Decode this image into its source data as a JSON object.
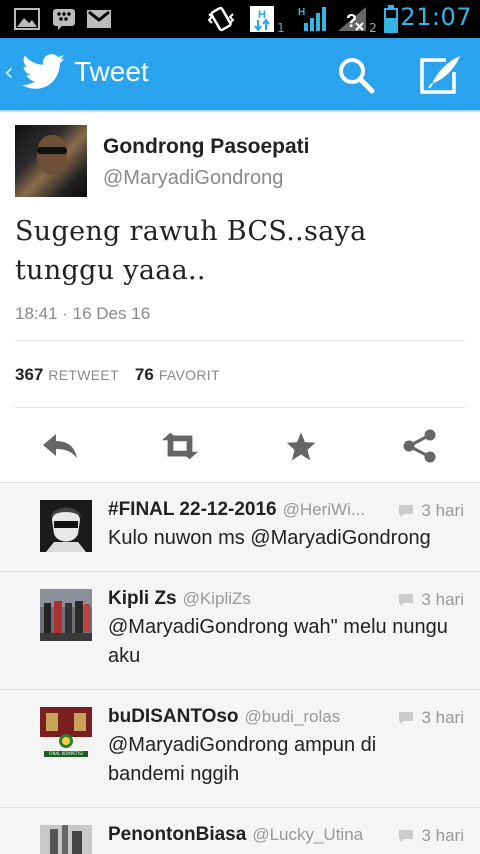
{
  "status_bar": {
    "time": "21:07",
    "network_h1": "H",
    "sim1": "1",
    "network_h2": "H",
    "sim2": "2",
    "icons": [
      "image-icon",
      "bbm-icon",
      "gmail-icon",
      "vibrate-icon",
      "download-icon",
      "signal-icon",
      "no-signal-icon",
      "battery-icon"
    ]
  },
  "action_bar": {
    "title": "Tweet",
    "back_icon": "chevron-left-icon",
    "logo_icon": "twitter-bird-icon",
    "search_icon": "search-icon",
    "compose_icon": "compose-icon"
  },
  "tweet": {
    "name": "Gondrong Pasoepati",
    "handle": "@MaryadiGondrong",
    "text": "Sugeng rawuh BCS..saya tunggu yaaa..",
    "timestamp": "18:41 · 16 Des 16",
    "retweets": "367",
    "retweets_label": "RETWEET",
    "favorites": "76",
    "favorites_label": "FAVORIT"
  },
  "actions": [
    {
      "name": "reply-icon"
    },
    {
      "name": "retweet-icon"
    },
    {
      "name": "favorite-icon"
    },
    {
      "name": "share-icon"
    }
  ],
  "replies": [
    {
      "name": "#FINAL 22-12-2016",
      "handle": "@HeriWi...",
      "time": "3 hari",
      "text": "Kulo nuwon ms @MaryadiGondrong"
    },
    {
      "name": "Kipli Zs",
      "handle": "@KipliZs",
      "time": "3 hari",
      "text": "@MaryadiGondrong wah\" melu nungu aku"
    },
    {
      "name": "buDISANTOso",
      "handle": "@budi_rolas",
      "time": "3 hari",
      "text": "@MaryadiGondrong ampun di bandemi nggih",
      "avatar_caption": "FINAL KOMPETISI"
    },
    {
      "name": "PenontonBiasa",
      "handle": "@Lucky_Utina",
      "time": "3 hari",
      "text": ""
    }
  ],
  "colors": {
    "accent": "#2aa3ef",
    "status_time": "#33b5e5",
    "icon_gray": "#666666",
    "reply_bg": "#f5f5f5"
  }
}
